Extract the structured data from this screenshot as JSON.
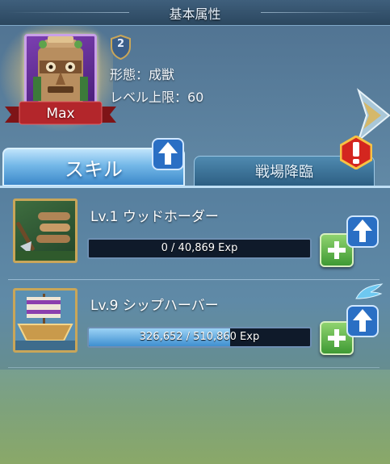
{
  "header": {
    "title": "基本属性"
  },
  "hero": {
    "rank_label": "Max",
    "level_badge": "2",
    "form_line": "形態：成獣",
    "level_cap_line": "レベル上限：60"
  },
  "tabs": [
    {
      "label": "スキル",
      "active": true
    },
    {
      "label": "戦場降臨",
      "active": false
    }
  ],
  "skills": [
    {
      "name": "Lv.1 ウッドホーダー",
      "exp_text": "0 / 40,869 Exp",
      "progress": 0.0
    },
    {
      "name": "Lv.9 シップハーバー",
      "exp_text": "326,652 / 510,860 Exp",
      "progress": 0.64
    }
  ],
  "colors": {
    "accent_blue": "#3c88c9",
    "plus_green": "#3f9a34",
    "ribbon_red": "#b3262b",
    "portrait_purple": "#7b3fb0"
  }
}
